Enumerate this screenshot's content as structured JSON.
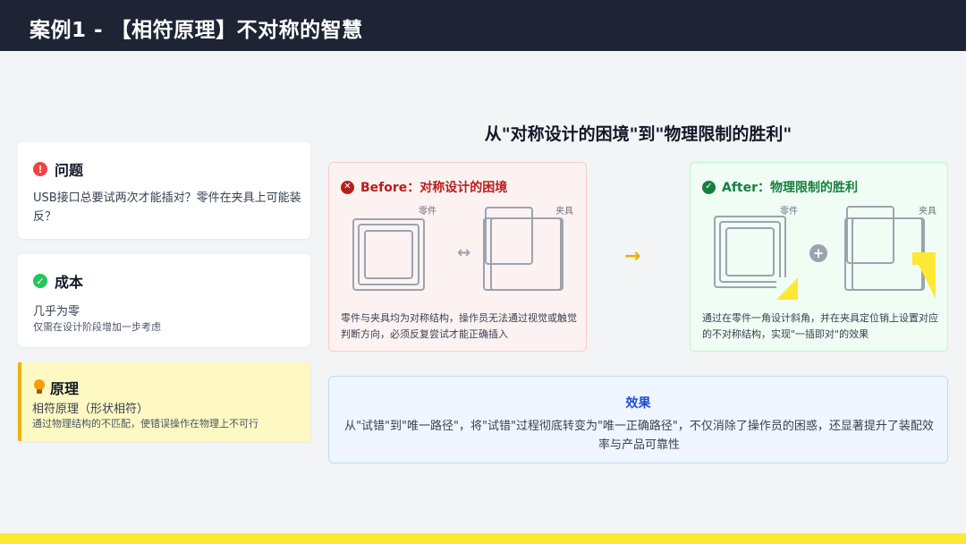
{
  "header": {
    "title": "案例1 - 【相符原理】不对称的智慧"
  },
  "problem": {
    "title": "问题",
    "icon": "exclamation-icon",
    "text": "USB接口总要试两次才能插对？零件在夹具上可能装反？"
  },
  "cost": {
    "title": "成本",
    "icon": "check-icon",
    "line1": "几乎为零",
    "line2": "仅需在设计阶段增加一步考虑"
  },
  "principle": {
    "title": "原理",
    "icon": "lightbulb-icon",
    "line1": "相符原理（形状相符）",
    "line2": "通过物理结构的不匹配，使错误操作在物理上不可行"
  },
  "main_title": "从\"对称设计的困境\"到\"物理限制的胜利\"",
  "before": {
    "title": "Before：对称设计的困境",
    "icon": "x-icon",
    "part_label": "零件",
    "fixture_label": "夹具",
    "symbol": "↔",
    "desc": "零件与夹具均为对称结构，操作员无法通过视觉或触觉判断方向，必须反复尝试才能正确插入"
  },
  "transition_symbol": "→",
  "after": {
    "title": "After：物理限制的胜利",
    "icon": "check-icon",
    "part_label": "零件",
    "fixture_label": "夹具",
    "symbol": "+",
    "desc": "通过在零件一角设计斜角，并在夹具定位销上设置对应的不对称结构，实现\"一插即对\"的效果"
  },
  "effect": {
    "title": "效果",
    "text": "从\"试错\"到\"唯一路径\"，将\"试错\"过程彻底转变为\"唯一正确路径\"，不仅消除了操作员的困惑，还显著提升了装配效率与产品可靠性"
  },
  "colors": {
    "header_bg": "#1e2433",
    "accent_yellow": "#fde833",
    "before_red": "#b91c1c",
    "after_green": "#15803d",
    "effect_blue": "#1d4ed8"
  }
}
